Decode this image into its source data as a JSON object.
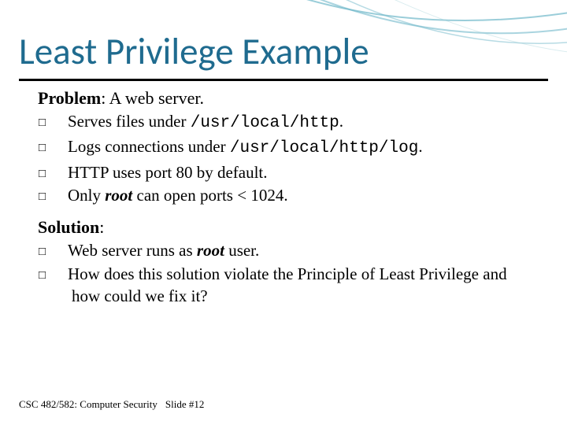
{
  "title": "Least Privilege Example",
  "problem": {
    "label": "Problem",
    "tail": ": A web server.",
    "items": [
      {
        "pre": "Serves files under ",
        "mono": "/usr/local/http",
        "post": "."
      },
      {
        "pre": "Logs connections under ",
        "mono": "/usr/local/http/log",
        "post": "."
      },
      {
        "pre": "HTTP uses port 80 by default.",
        "mono": "",
        "post": ""
      },
      {
        "pre": "Only ",
        "boldital": "root",
        "post": " can open ports < 1024."
      }
    ]
  },
  "solution": {
    "label": "Solution",
    "tail": ":",
    "items": [
      {
        "pre": "Web server runs as ",
        "boldital": "root",
        "post": " user."
      },
      {
        "pre": "How does this solution violate the Principle of Least Privilege and how could we fix it?",
        "boldital": "",
        "post": ""
      }
    ]
  },
  "footer": {
    "course": "CSC 482/582: Computer Security",
    "slide": "Slide #12"
  },
  "marker": "□"
}
